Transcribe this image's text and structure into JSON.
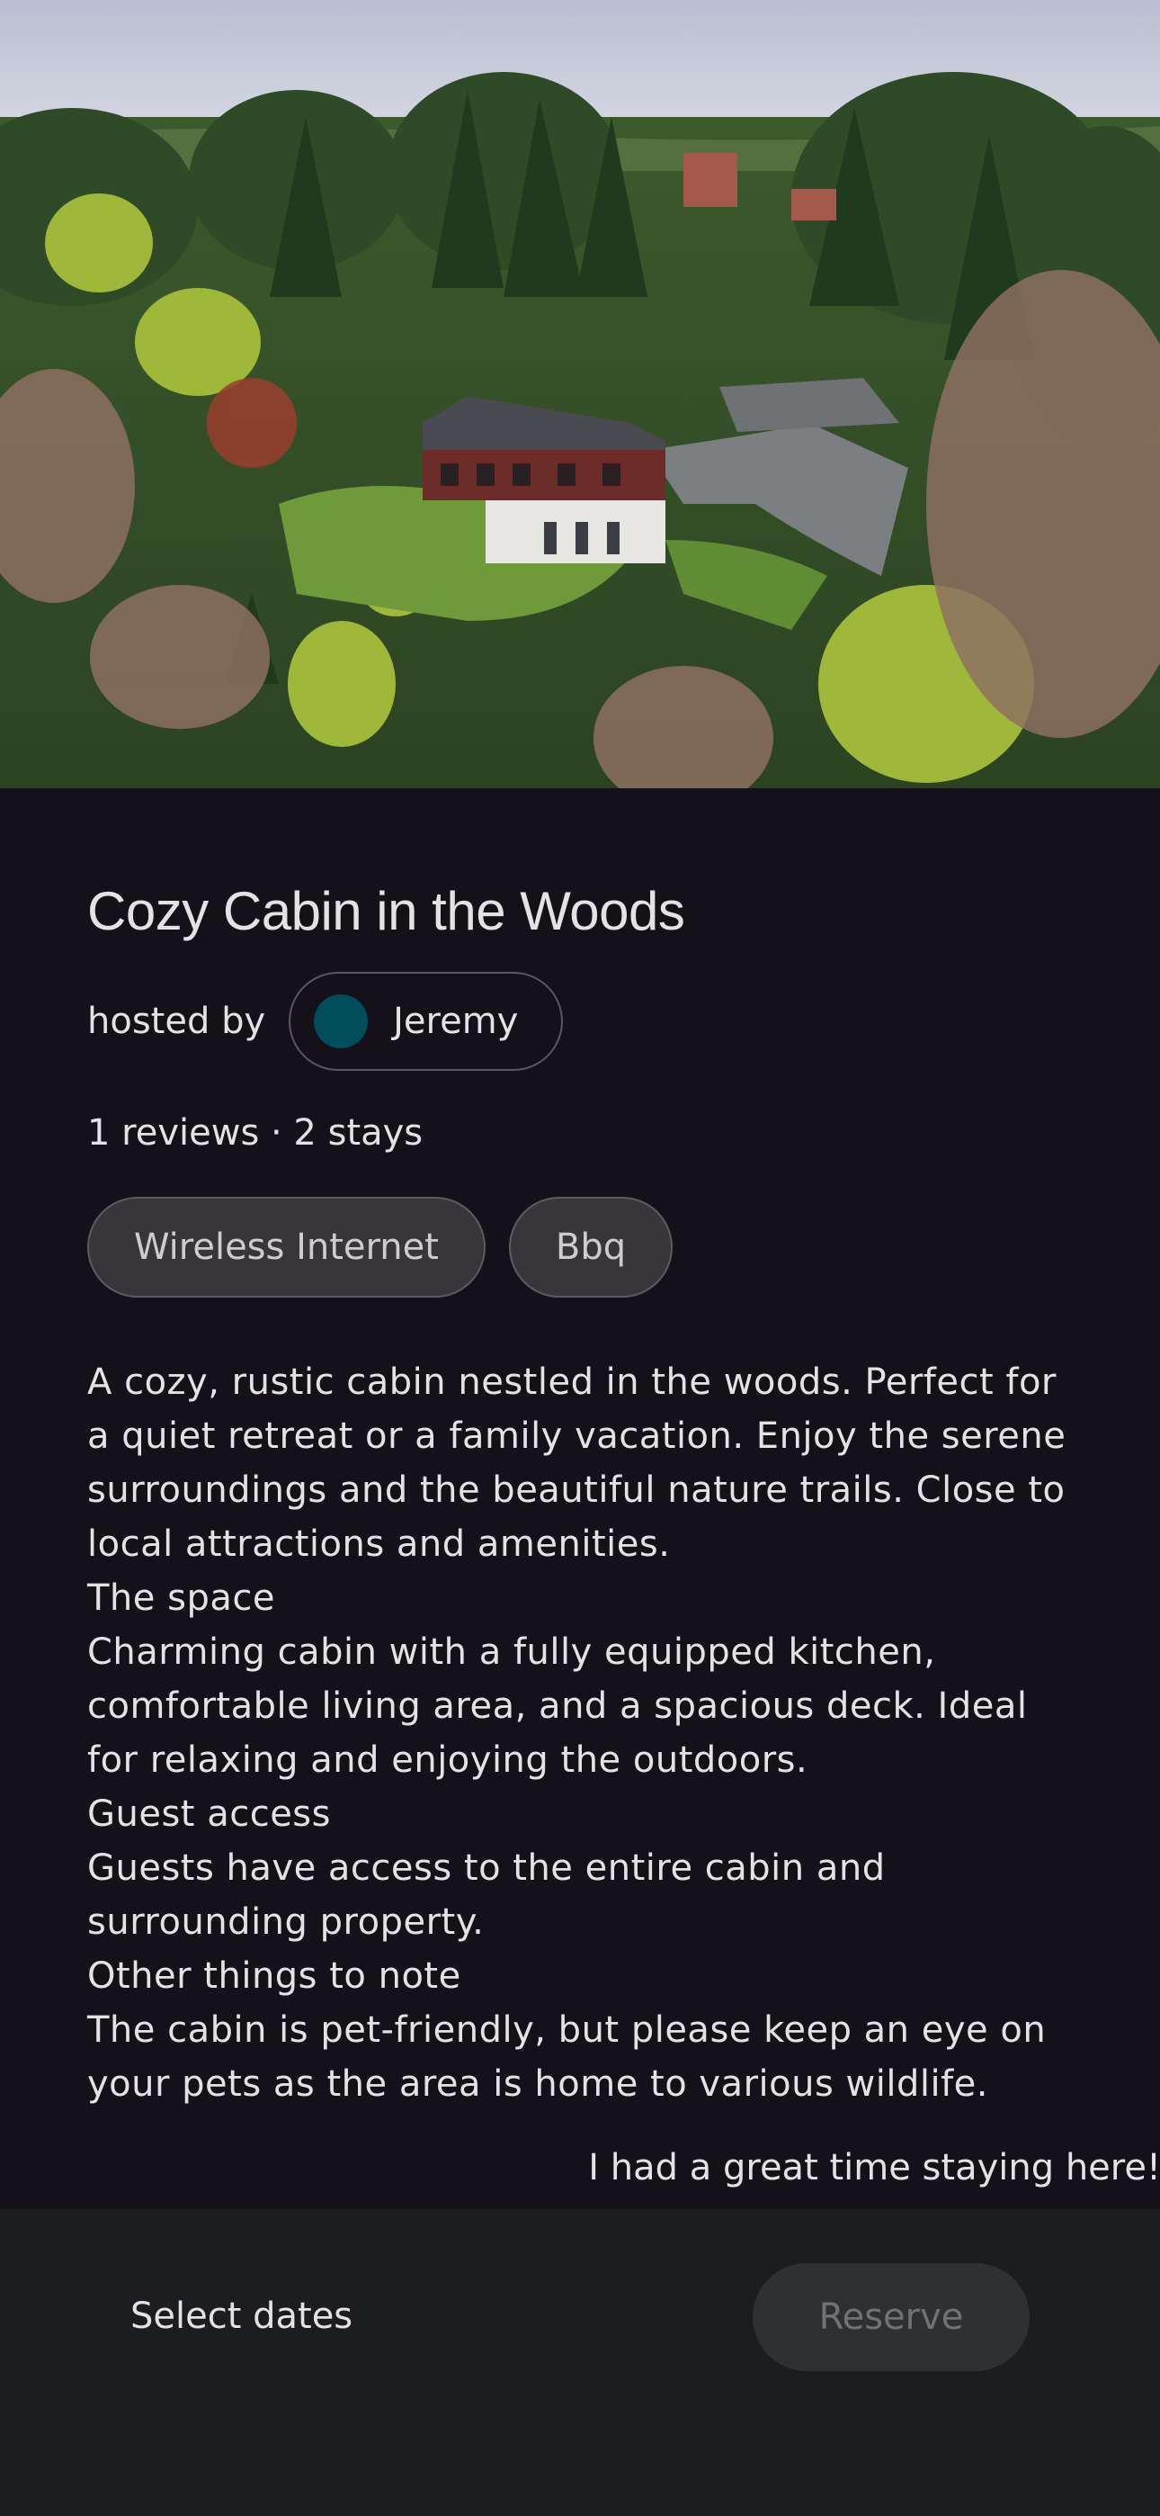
{
  "listing": {
    "title": "Cozy Cabin in the Woods",
    "hosted_by_label": "hosted by",
    "host_name": "Jeremy",
    "host_avatar_color": "#004d5c",
    "stats": "1 reviews · 2 stays",
    "amenities": [
      {
        "label": "Wireless Internet"
      },
      {
        "label": "Bbq"
      }
    ],
    "description": [
      "A cozy, rustic cabin nestled in the woods. Perfect for a quiet retreat or a family vacation. Enjoy the serene surroundings and the beautiful nature trails. Close to local attractions and amenities.",
      "The space",
      "Charming cabin with a fully equipped kitchen, comfortable living area, and a spacious deck. Ideal for relaxing and enjoying the outdoors.",
      "Guest access",
      "Guests have access to the entire cabin and surrounding property.",
      "Other things to note",
      "The cabin is pet-friendly, but please keep an eye on your pets as the area is home to various wildlife."
    ],
    "review_snippet": "I had a great time staying here!"
  },
  "bottom_bar": {
    "select_dates_label": "Select dates",
    "reserve_label": "Reserve"
  },
  "colors": {
    "background": "#141218",
    "bottom_bar": "#1b1d20",
    "chip_fill": "#38363b",
    "reserve_disabled": "#2e3134"
  }
}
